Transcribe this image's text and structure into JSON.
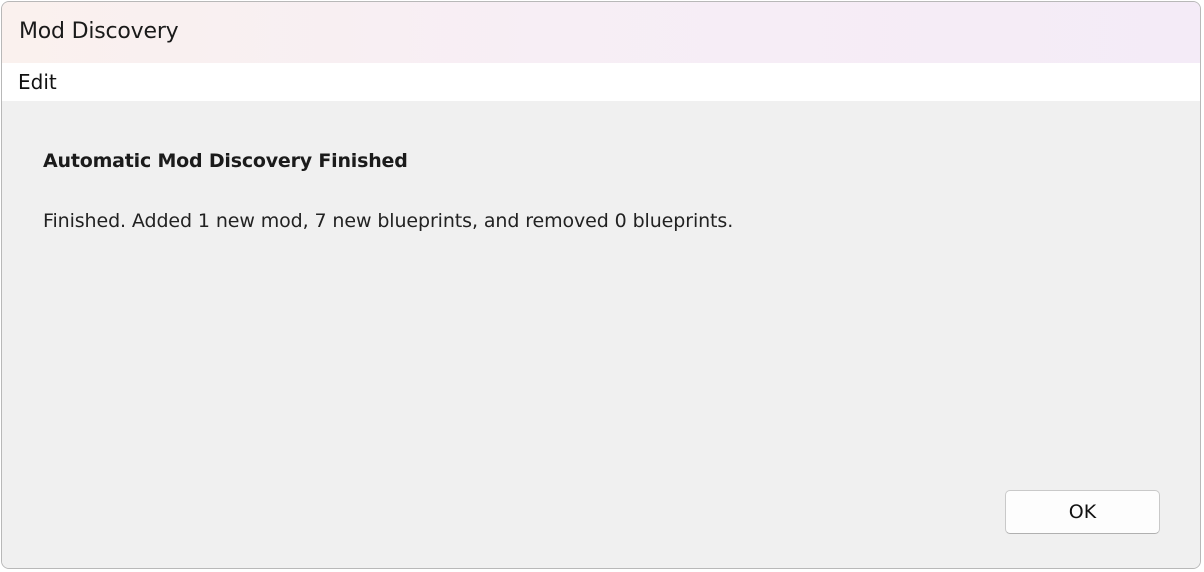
{
  "window": {
    "title": "Mod Discovery"
  },
  "menubar": {
    "items": [
      {
        "label": "Edit"
      }
    ]
  },
  "dialog": {
    "heading": "Automatic Mod Discovery Finished",
    "message": "Finished. Added 1 new mod, 7 new blueprints, and removed 0 blueprints.",
    "ok_label": "OK"
  }
}
